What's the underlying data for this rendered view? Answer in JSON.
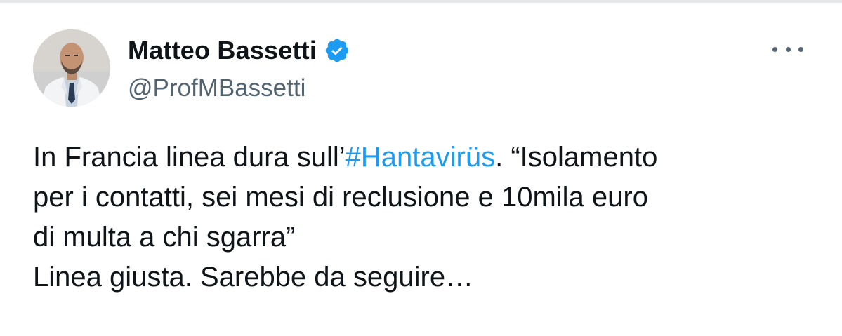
{
  "colors": {
    "text": "#0f1419",
    "secondary": "#536471",
    "accent": "#1d9bf0"
  },
  "author": {
    "display_name": "Matteo Bassetti",
    "handle": "@ProfMBassetti",
    "verified_icon": "verified-badge-icon",
    "avatar": "profile-photo"
  },
  "menu": {
    "icon": "more-options-icon"
  },
  "tweet": {
    "line1_pre": "In Francia linea dura sull’",
    "hashtag": "#Hantavirüs",
    "line1_post": ". “Isolamento",
    "line2": "per i contatti, sei mesi di reclusione e 10mila euro",
    "line3": "di multa a chi sgarra”",
    "line4": "Linea giusta. Sarebbe da seguire…"
  }
}
